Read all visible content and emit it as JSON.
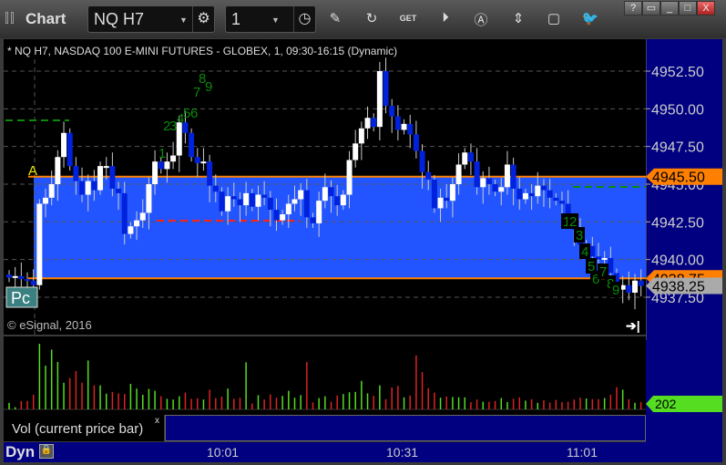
{
  "window": {
    "title": "Chart",
    "symbol": "NQ H7",
    "interval": "1",
    "buttons": [
      "?",
      "▭",
      "_",
      "□",
      "X"
    ]
  },
  "toolbar": {
    "icons": [
      "settings-icon",
      "clock-icon",
      "pencil-icon",
      "refresh-icon",
      "get-icon",
      "play-icon",
      "alert-icon",
      "link-icon",
      "comment-icon",
      "twitter-icon"
    ],
    "get_label": "GET"
  },
  "chart": {
    "header": "* NQ H7, NASDAQ 100 E-MINI FUTURES - GLOBEX, 1, 09:30-16:15 (Dynamic)",
    "copyright": "© eSignal, 2016",
    "marker_a": "A",
    "marker_pc": "Pc",
    "price_ticks": [
      "4952.50",
      "4950.00",
      "4947.50",
      "4945.00",
      "4942.50",
      "4940.00",
      "4937.50"
    ],
    "price_tick_values": [
      4952.5,
      4950,
      4947.5,
      4945,
      4942.5,
      4940,
      4937.5
    ],
    "range_high": "4945.50",
    "range_low": "4938.75",
    "last_price": "4938.25",
    "range_high_value": 4945.5,
    "range_low_value": 4938.75,
    "last_value": 4938.25,
    "colors": {
      "range_fill": "#2255ff",
      "range_line": "#ff8000",
      "up": "#ffffff",
      "down": "#0022dd",
      "seq": "#0a8a0a",
      "axis_bg": "#000080"
    },
    "closes": [
      4938.8,
      4938.9,
      4938.7,
      4938.6,
      4938.3,
      4943.7,
      4944.1,
      4945.0,
      4946.8,
      4948.4,
      4946.2,
      4945.2,
      4944.3,
      4945.2,
      4944.6,
      4946.2,
      4946.2,
      4944.7,
      4944.4,
      4941.7,
      4942.2,
      4942.6,
      4943.1,
      4945.0,
      4946.5,
      4946.0,
      4946.5,
      4946.9,
      4949.1,
      4948.4,
      4946.8,
      4946.4,
      4946.5,
      4944.9,
      4944.5,
      4943.2,
      4944.2,
      4944.0,
      4943.6,
      4944.4,
      4943.5,
      4944.3,
      4944.1,
      4943.3,
      4942.6,
      4943.0,
      4943.7,
      4944.0,
      4944.6,
      4942.8,
      4942.4,
      4943.9,
      4944.8,
      4944.2,
      4943.6,
      4944.3,
      4946.6,
      4947.7,
      4948.7,
      4949.4,
      4948.8,
      4952.5,
      4950.2,
      4949.5,
      4948.6,
      4949.0,
      4948.3,
      4947.2,
      4945.8,
      4945.3,
      4943.4,
      4944.1,
      4943.9,
      4945.0,
      4946.3,
      4947.1,
      4946.5,
      4944.8,
      4945.4,
      4945.0,
      4944.5,
      4944.8,
      4946.3,
      4944.7,
      4944.0,
      4944.4,
      4944.2,
      4944.9,
      4944.6,
      4944.1,
      4943.9,
      4943.7,
      4942.6,
      4942.0,
      4941.0,
      4940.9,
      4940.2,
      4940.0,
      4940.1,
      4939.1,
      4938.0,
      4938.3,
      4937.8,
      4938.6,
      4938.25
    ],
    "sequence_top": [
      "1",
      "2",
      "3",
      "4",
      "5",
      "6",
      "7",
      "8",
      "9"
    ],
    "sequence_bottom": [
      "1",
      "2",
      "3",
      "4",
      "5",
      "6",
      "7",
      "8",
      "9"
    ]
  },
  "volume": {
    "label": "Vol (current price bar)",
    "close_label": "x",
    "last": "202",
    "last_value": 202,
    "color_up": "#55dd22",
    "color_down": "#dd2222",
    "values": [
      180,
      60,
      230,
      230,
      400,
      1800,
      1200,
      1640,
      1300,
      730,
      860,
      1050,
      730,
      1340,
      660,
      660,
      430,
      480,
      440,
      420,
      700,
      570,
      400,
      560,
      510,
      360,
      290,
      270,
      360,
      460,
      290,
      300,
      270,
      540,
      310,
      350,
      570,
      290,
      320,
      1290,
      160,
      390,
      270,
      410,
      320,
      370,
      510,
      320,
      390,
      1300,
      190,
      310,
      360,
      210,
      380,
      420,
      470,
      480,
      780,
      440,
      370,
      660,
      280,
      600,
      640,
      330,
      380,
      1480,
      1020,
      580,
      460,
      320,
      350,
      340,
      330,
      330,
      200,
      270,
      210,
      210,
      230,
      310,
      200,
      290,
      330,
      240,
      280,
      180,
      250,
      190,
      260,
      200,
      210,
      270,
      320,
      300,
      280,
      280,
      310,
      400,
      610,
      540,
      280,
      180,
      202
    ],
    "dirs": [
      1,
      1,
      0,
      0,
      0,
      1,
      1,
      1,
      1,
      1,
      0,
      0,
      0,
      1,
      0,
      1,
      1,
      0,
      0,
      0,
      1,
      1,
      1,
      1,
      1,
      0,
      1,
      1,
      1,
      0,
      0,
      0,
      1,
      0,
      0,
      0,
      1,
      0,
      0,
      1,
      0,
      1,
      0,
      0,
      0,
      1,
      1,
      1,
      1,
      0,
      0,
      1,
      1,
      0,
      0,
      1,
      1,
      1,
      1,
      1,
      0,
      1,
      0,
      0,
      0,
      1,
      0,
      0,
      0,
      0,
      0,
      1,
      0,
      1,
      1,
      1,
      0,
      0,
      1,
      0,
      0,
      1,
      1,
      0,
      0,
      1,
      0,
      1,
      0,
      0,
      0,
      0,
      0,
      0,
      0,
      1,
      0,
      0,
      1,
      0,
      0,
      1,
      0,
      1,
      0
    ]
  },
  "time_axis": {
    "labels": [
      "10:01",
      "10:31",
      "11:01"
    ],
    "mode": "Dyn"
  }
}
